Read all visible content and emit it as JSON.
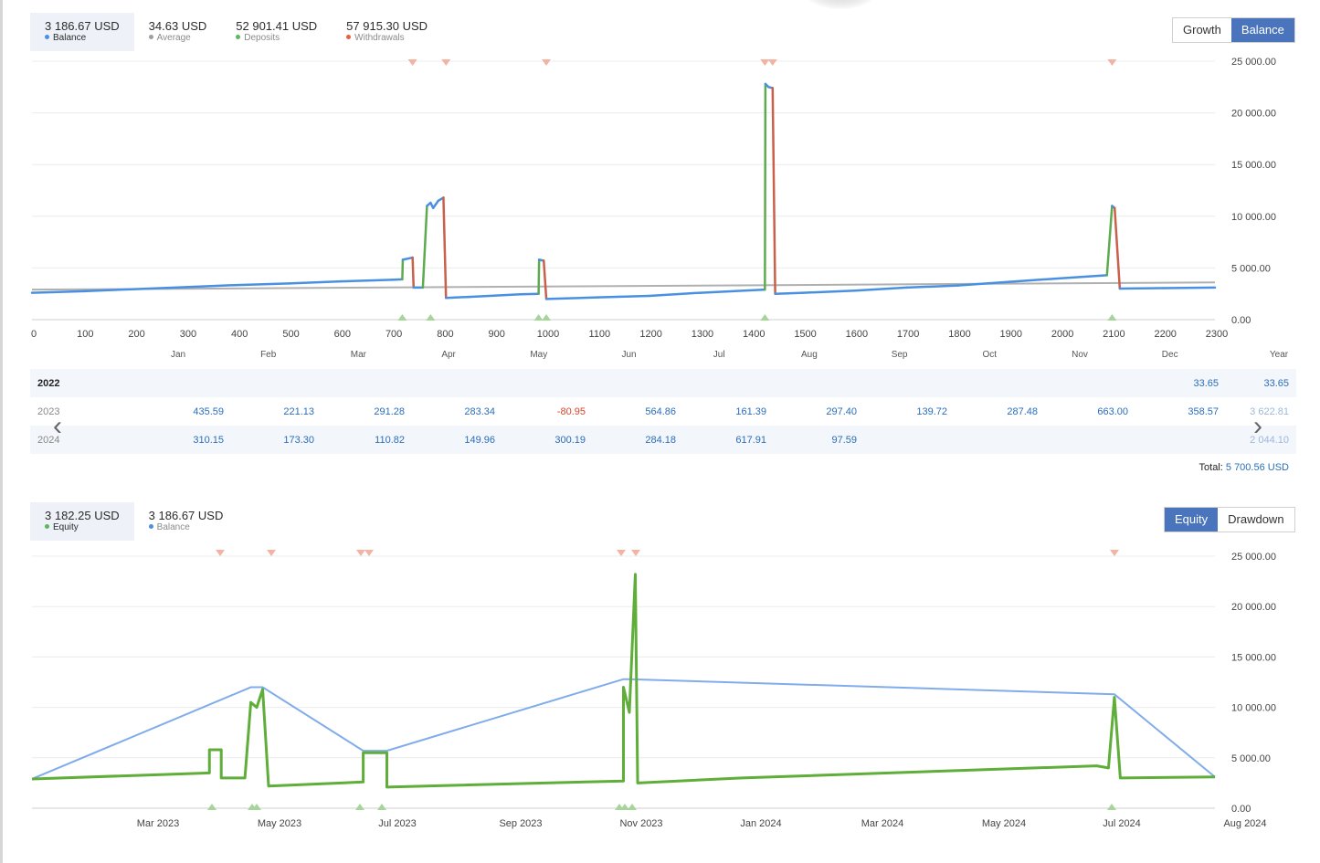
{
  "balance_panel": {
    "stats": [
      {
        "value": "3 186.67 USD",
        "label": "Balance",
        "color": "#4a90e2"
      },
      {
        "value": "34.63 USD",
        "label": "Average",
        "color": "#9e9e9e"
      },
      {
        "value": "52 901.41 USD",
        "label": "Deposits",
        "color": "#5cb85c"
      },
      {
        "value": "57 915.30 USD",
        "label": "Withdrawals",
        "color": "#e8603c"
      }
    ],
    "toggle": {
      "growth": "Growth",
      "balance": "Balance",
      "active": "Balance"
    }
  },
  "monthly_table": {
    "headers": [
      "Jan",
      "Feb",
      "Mar",
      "Apr",
      "May",
      "Jun",
      "Jul",
      "Aug",
      "Sep",
      "Oct",
      "Nov",
      "Dec",
      "Year"
    ],
    "rows": [
      {
        "year": "2022",
        "values": [
          "",
          "",
          "",
          "",
          "",
          "",
          "",
          "",
          "",
          "",
          "",
          "33.65",
          "33.65"
        ]
      },
      {
        "year": "2023",
        "values": [
          "435.59",
          "221.13",
          "291.28",
          "283.34",
          "-80.95",
          "564.86",
          "161.39",
          "297.40",
          "139.72",
          "287.48",
          "663.00",
          "358.57",
          "3 622.81"
        ]
      },
      {
        "year": "2024",
        "values": [
          "310.15",
          "173.30",
          "110.82",
          "149.96",
          "300.19",
          "284.18",
          "617.91",
          "97.59",
          "",
          "",
          "",
          "",
          "2 044.10"
        ]
      }
    ],
    "total_label": "Total:",
    "total_value": "5 700.56 USD"
  },
  "equity_panel": {
    "stats": [
      {
        "value": "3 182.25 USD",
        "label": "Equity",
        "color": "#5cb85c"
      },
      {
        "value": "3 186.67 USD",
        "label": "Balance",
        "color": "#4a90e2"
      }
    ],
    "toggle": {
      "equity": "Equity",
      "drawdown": "Drawdown",
      "active": "Equity"
    }
  },
  "chart_data": [
    {
      "type": "line",
      "title": "",
      "x_axis": {
        "min": 0,
        "max": 2300,
        "ticks": [
          0,
          100,
          200,
          300,
          400,
          500,
          600,
          700,
          800,
          900,
          1000,
          1100,
          1200,
          1300,
          1400,
          1500,
          1600,
          1700,
          1800,
          1900,
          2000,
          2100,
          2200,
          2300
        ]
      },
      "y_axis": {
        "min": 0,
        "max": 25000,
        "ticks": [
          "0.00",
          "5 000.00",
          "10 000.00",
          "15 000.00",
          "20 000.00",
          "25 000.00"
        ]
      },
      "grid": true,
      "series": [
        {
          "name": "Balance",
          "color": "#4a90e2",
          "points": [
            [
              0,
              2600
            ],
            [
              100,
              2750
            ],
            [
              200,
              2950
            ],
            [
              300,
              3150
            ],
            [
              400,
              3350
            ],
            [
              500,
              3500
            ],
            [
              600,
              3700
            ],
            [
              700,
              3850
            ],
            [
              720,
              3900
            ],
            [
              721,
              5800
            ],
            [
              740,
              6000
            ],
            [
              742,
              3100
            ],
            [
              760,
              3100
            ],
            [
              768,
              11000
            ],
            [
              775,
              11300
            ],
            [
              780,
              10800
            ],
            [
              790,
              11500
            ],
            [
              800,
              11800
            ],
            [
              805,
              2100
            ],
            [
              850,
              2200
            ],
            [
              950,
              2450
            ],
            [
              985,
              2500
            ],
            [
              986,
              5800
            ],
            [
              995,
              5700
            ],
            [
              1000,
              2000
            ],
            [
              1100,
              2150
            ],
            [
              1200,
              2300
            ],
            [
              1300,
              2600
            ],
            [
              1425,
              2900
            ],
            [
              1426,
              22800
            ],
            [
              1432,
              22500
            ],
            [
              1440,
              22400
            ],
            [
              1445,
              2500
            ],
            [
              1500,
              2600
            ],
            [
              1600,
              2800
            ],
            [
              1700,
              3100
            ],
            [
              1800,
              3300
            ],
            [
              1900,
              3650
            ],
            [
              2000,
              4000
            ],
            [
              2090,
              4300
            ],
            [
              2100,
              11000
            ],
            [
              2105,
              10800
            ],
            [
              2115,
              3000
            ],
            [
              2200,
              3050
            ],
            [
              2300,
              3100
            ]
          ]
        },
        {
          "name": "Average",
          "color": "#b0b0b0",
          "points": [
            [
              0,
              2900
            ],
            [
              2300,
              3600
            ]
          ]
        }
      ],
      "deposit_markers_x": [
        720,
        775,
        985,
        1000,
        1425,
        2100
      ],
      "withdrawal_markers_x": [
        740,
        805,
        1000,
        1425,
        1440,
        2100
      ],
      "month_labels": [
        "Jan",
        "Feb",
        "Mar",
        "Apr",
        "May",
        "Jun",
        "Jul",
        "Aug",
        "Sep",
        "Oct",
        "Nov",
        "Dec",
        "Year"
      ]
    },
    {
      "type": "line",
      "title": "",
      "x_axis": {
        "ticks": [
          "Mar 2023",
          "May 2023",
          "Jul 2023",
          "Sep 2023",
          "Nov 2023",
          "Jan 2024",
          "Mar 2024",
          "May 2024",
          "Jul 2024",
          "Aug 2024"
        ]
      },
      "y_axis": {
        "min": 0,
        "max": 25000,
        "ticks": [
          "0.00",
          "5 000.00",
          "10 000.00",
          "15 000.00",
          "20 000.00",
          "25 000.00"
        ]
      },
      "grid": true,
      "series": [
        {
          "name": "Equity",
          "color": "#5fae3a",
          "points": [
            [
              0,
              2900
            ],
            [
              0.1,
              3300
            ],
            [
              0.15,
              3500
            ],
            [
              0.15,
              5800
            ],
            [
              0.16,
              5800
            ],
            [
              0.16,
              3000
            ],
            [
              0.18,
              3000
            ],
            [
              0.185,
              10500
            ],
            [
              0.19,
              10000
            ],
            [
              0.195,
              11800
            ],
            [
              0.2,
              2200
            ],
            [
              0.28,
              2600
            ],
            [
              0.28,
              5500
            ],
            [
              0.3,
              5500
            ],
            [
              0.3,
              2100
            ],
            [
              0.5,
              2700
            ],
            [
              0.5,
              12000
            ],
            [
              0.505,
              9500
            ],
            [
              0.51,
              23200
            ],
            [
              0.512,
              2500
            ],
            [
              0.6,
              3000
            ],
            [
              0.8,
              3800
            ],
            [
              0.9,
              4200
            ],
            [
              0.91,
              4000
            ],
            [
              0.915,
              11000
            ],
            [
              0.92,
              3000
            ],
            [
              1,
              3100
            ]
          ]
        },
        {
          "name": "Balance",
          "color": "#6a9ee8",
          "points": [
            [
              0,
              2900
            ],
            [
              0.185,
              12000
            ],
            [
              0.195,
              12000
            ],
            [
              0.28,
              5700
            ],
            [
              0.3,
              5700
            ],
            [
              0.5,
              12800
            ],
            [
              0.505,
              12800
            ],
            [
              0.915,
              11300
            ],
            [
              1,
              3100
            ]
          ]
        }
      ]
    }
  ]
}
